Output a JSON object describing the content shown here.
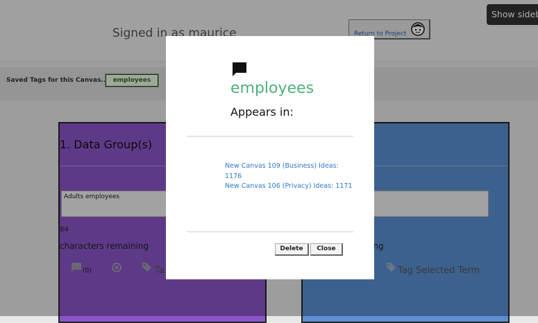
{
  "header": {
    "signed_in": "Signed in as maurice",
    "return_label": "Return to Project",
    "sidebar_label": "Show sideb"
  },
  "tagbar": {
    "label": "Saved Tags for this Canvas...",
    "tag": "employees"
  },
  "panels": {
    "left": {
      "title": "1. Data Group(s)",
      "input_value": "Adults employees",
      "count": "84",
      "remaining": "characters remaining",
      "comment_count": "(0)",
      "tag_label": "Ta"
    },
    "right": {
      "remaining": "ing",
      "tag_label": "Tag Selected Term"
    }
  },
  "modal": {
    "title": "employees",
    "appears": "Appears in:",
    "links": [
      "New Canvas 109 (Business) Ideas: 1176",
      "New Canvas 106 (Privacy) Ideas: 1171"
    ],
    "delete_label": "Delete",
    "close_label": "Close"
  },
  "colors": {
    "accent_green": "#4db27d",
    "link_blue": "#2d78c8",
    "panel_left": "#8a55c8",
    "panel_right": "#5b8fd2"
  }
}
